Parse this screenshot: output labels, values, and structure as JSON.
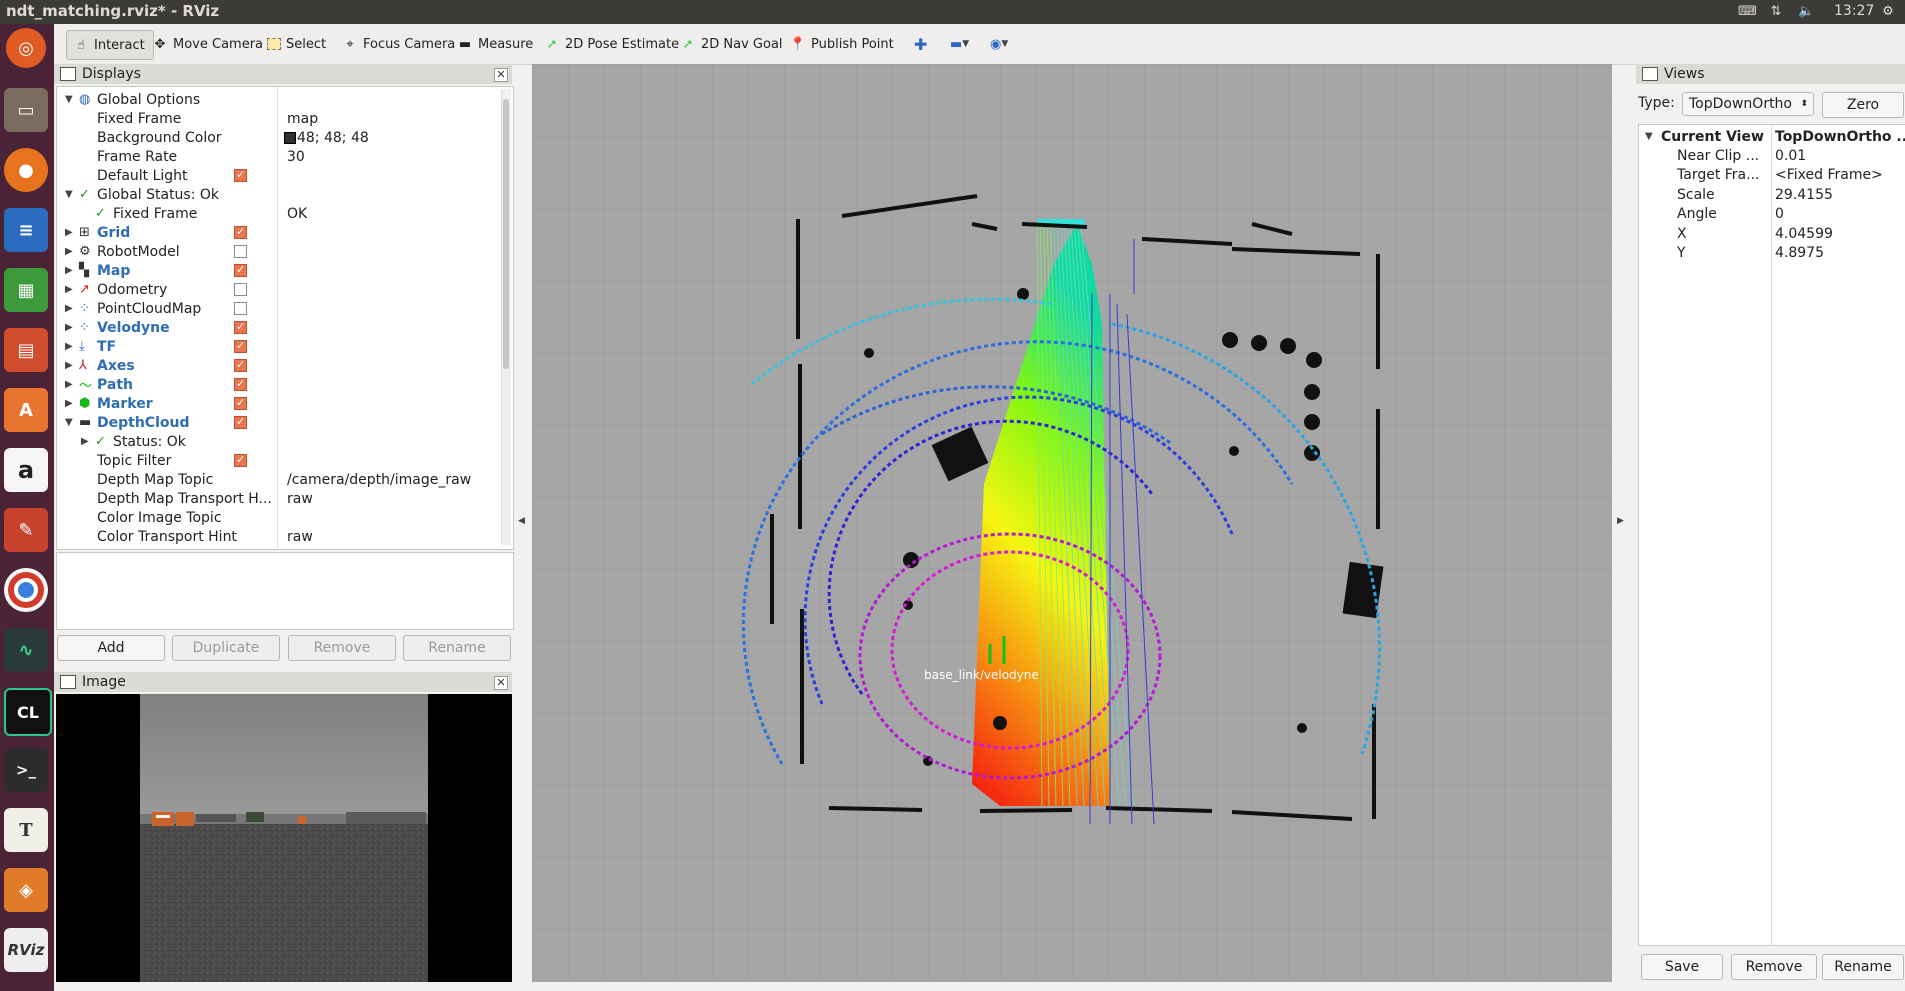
{
  "window": {
    "title": "ndt_matching.rviz* - RViz",
    "clock": "13:27"
  },
  "launcher": {
    "items": [
      "ubuntu-logo-icon",
      "files-icon",
      "firefox-icon",
      "writer-icon",
      "calc-icon",
      "impress-icon",
      "software-center-icon",
      "amazon-icon",
      "system-settings-icon",
      "chrome-icon",
      "system-monitor-icon",
      "clion-icon",
      "terminal-icon",
      "text-editor-icon",
      "sublime-icon",
      "rviz-icon"
    ],
    "clion_label": "CL",
    "rviz_label": "RViz",
    "amazon_label": "a",
    "text_label": "T"
  },
  "toolbar": {
    "interact": "Interact",
    "move_camera": "Move Camera",
    "select": "Select",
    "focus_camera": "Focus Camera",
    "measure": "Measure",
    "pose_estimate": "2D Pose Estimate",
    "nav_goal": "2D Nav Goal",
    "publish_point": "Publish Point"
  },
  "displays": {
    "title": "Displays",
    "rows": [
      {
        "label": "Global Options",
        "value": "",
        "indent": 0,
        "arrow": "▼",
        "icon": "globe-icon",
        "check": null,
        "style": ""
      },
      {
        "label": "Fixed Frame",
        "value": "map",
        "indent": 1,
        "arrow": "",
        "icon": "",
        "check": null,
        "style": ""
      },
      {
        "label": "Background Color",
        "value": "48; 48; 48",
        "indent": 1,
        "arrow": "",
        "icon": "",
        "check": null,
        "style": "",
        "swatch": "#303030"
      },
      {
        "label": "Frame Rate",
        "value": "30",
        "indent": 1,
        "arrow": "",
        "icon": "",
        "check": null,
        "style": ""
      },
      {
        "label": "Default Light",
        "value": "",
        "indent": 1,
        "arrow": "",
        "icon": "",
        "check": true,
        "style": ""
      },
      {
        "label": "Global Status: Ok",
        "value": "",
        "indent": 0,
        "arrow": "▼",
        "icon": "status-ok-icon",
        "check": null,
        "style": ""
      },
      {
        "label": "Fixed Frame",
        "value": "OK",
        "indent": 1,
        "arrow": "",
        "icon": "status-ok-icon",
        "check": null,
        "style": ""
      },
      {
        "label": "Grid",
        "value": "",
        "indent": 0,
        "arrow": "▶",
        "icon": "grid-icon",
        "check": true,
        "style": "blue"
      },
      {
        "label": "RobotModel",
        "value": "",
        "indent": 0,
        "arrow": "▶",
        "icon": "robot-model-icon",
        "check": false,
        "style": ""
      },
      {
        "label": "Map",
        "value": "",
        "indent": 0,
        "arrow": "▶",
        "icon": "map-icon",
        "check": true,
        "style": "blue"
      },
      {
        "label": "Odometry",
        "value": "",
        "indent": 0,
        "arrow": "▶",
        "icon": "odometry-icon",
        "check": false,
        "style": ""
      },
      {
        "label": "PointCloudMap",
        "value": "",
        "indent": 0,
        "arrow": "▶",
        "icon": "pointcloud-icon",
        "check": false,
        "style": ""
      },
      {
        "label": "Velodyne",
        "value": "",
        "indent": 0,
        "arrow": "▶",
        "icon": "pointcloud-icon",
        "check": true,
        "style": "blue"
      },
      {
        "label": "TF",
        "value": "",
        "indent": 0,
        "arrow": "▶",
        "icon": "tf-icon",
        "check": true,
        "style": "blue"
      },
      {
        "label": "Axes",
        "value": "",
        "indent": 0,
        "arrow": "▶",
        "icon": "axes-icon",
        "check": true,
        "style": "blue"
      },
      {
        "label": "Path",
        "value": "",
        "indent": 0,
        "arrow": "▶",
        "icon": "path-icon",
        "check": true,
        "style": "blue"
      },
      {
        "label": "Marker",
        "value": "",
        "indent": 0,
        "arrow": "▶",
        "icon": "marker-icon",
        "check": true,
        "style": "blue"
      },
      {
        "label": "DepthCloud",
        "value": "",
        "indent": 0,
        "arrow": "▼",
        "icon": "depth-cloud-icon",
        "check": true,
        "style": "blue"
      },
      {
        "label": "Status: Ok",
        "value": "",
        "indent": 1,
        "arrow": "▶",
        "icon": "status-ok-icon",
        "check": null,
        "style": ""
      },
      {
        "label": "Topic Filter",
        "value": "",
        "indent": 1,
        "arrow": "",
        "icon": "",
        "check": true,
        "style": ""
      },
      {
        "label": "Depth Map Topic",
        "value": "/camera/depth/image_raw",
        "indent": 1,
        "arrow": "",
        "icon": "",
        "check": null,
        "style": ""
      },
      {
        "label": "Depth Map Transport H...",
        "value": "raw",
        "indent": 1,
        "arrow": "",
        "icon": "",
        "check": null,
        "style": ""
      },
      {
        "label": "Color Image Topic",
        "value": "",
        "indent": 1,
        "arrow": "",
        "icon": "",
        "check": null,
        "style": ""
      },
      {
        "label": "Color Transport Hint",
        "value": "raw",
        "indent": 1,
        "arrow": "",
        "icon": "",
        "check": null,
        "style": ""
      }
    ],
    "buttons": {
      "add": "Add",
      "duplicate": "Duplicate",
      "remove": "Remove",
      "rename": "Rename"
    }
  },
  "image_panel": {
    "title": "Image"
  },
  "viewport": {
    "frame_label": "base_link/velodyne"
  },
  "views": {
    "title": "Views",
    "type_label": "Type:",
    "type_value": "TopDownOrtho",
    "zero": "Zero",
    "header": {
      "label": "Current View",
      "value": "TopDownOrtho ..."
    },
    "rows": [
      {
        "label": "Near Clip ...",
        "value": "0.01"
      },
      {
        "label": "Target Fra...",
        "value": "<Fixed Frame>"
      },
      {
        "label": "Scale",
        "value": "29.4155"
      },
      {
        "label": "Angle",
        "value": "0"
      },
      {
        "label": "X",
        "value": "4.04599"
      },
      {
        "label": "Y",
        "value": "4.8975"
      }
    ],
    "buttons": {
      "save": "Save",
      "remove": "Remove",
      "rename": "Rename"
    }
  }
}
